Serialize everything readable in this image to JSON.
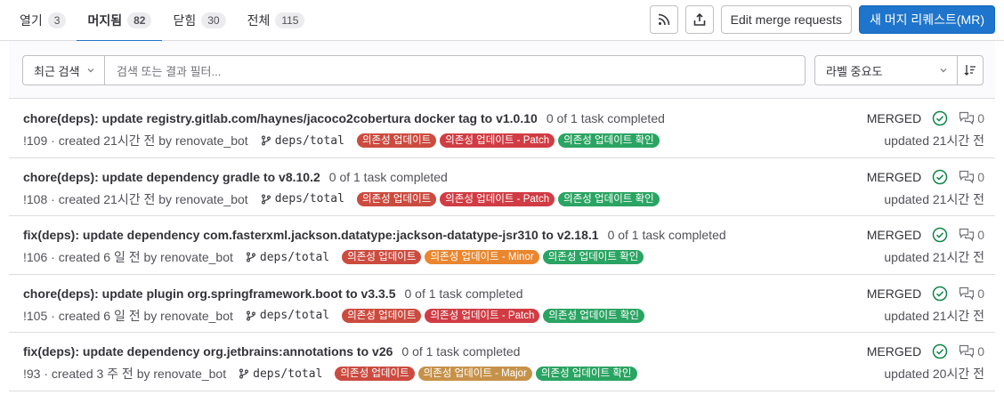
{
  "tabs": [
    {
      "label": "열기",
      "count": "3",
      "active": false
    },
    {
      "label": "머지됨",
      "count": "82",
      "active": true
    },
    {
      "label": "닫힘",
      "count": "30",
      "active": false
    },
    {
      "label": "전체",
      "count": "115",
      "active": false
    }
  ],
  "actions": {
    "rss_icon": "rss-icon",
    "export_icon": "export-icon",
    "edit_label": "Edit merge requests",
    "new_label": "새 머지 리퀘스트(MR)"
  },
  "filter": {
    "recent_label": "최근 검색",
    "search_placeholder": "검색 또는 결과 필터...",
    "sort_label": "라벨 중요도"
  },
  "colors": {
    "accent": "#1f75cb",
    "label_update": "#cc4b3f",
    "label_patch": "#d13c44",
    "label_minor": "#e9862e",
    "label_major": "#c6924a",
    "label_confirm": "#2aa462",
    "merged_check": "#108548"
  },
  "merge_requests": [
    {
      "title": "chore(deps): update registry.gitlab.com/haynes/jacoco2cobertura docker tag to v1.0.10",
      "tasks": "0 of 1 task completed",
      "meta": "!109 · created 21시간 전 by renovate_bot",
      "branch": "deps/total",
      "labels": [
        {
          "text": "의존성 업데이트",
          "color": "#cc4b3f"
        },
        {
          "text": "의존성 업데이트 - Patch",
          "color": "#d13c44"
        },
        {
          "text": "의존성 업데이트 확인",
          "color": "#2aa462"
        }
      ],
      "status": "MERGED",
      "comments": "0",
      "updated": "updated 21시간 전"
    },
    {
      "title": "chore(deps): update dependency gradle to v8.10.2",
      "tasks": "0 of 1 task completed",
      "meta": "!108 · created 21시간 전 by renovate_bot",
      "branch": "deps/total",
      "labels": [
        {
          "text": "의존성 업데이트",
          "color": "#cc4b3f"
        },
        {
          "text": "의존성 업데이트 - Patch",
          "color": "#d13c44"
        },
        {
          "text": "의존성 업데이트 확인",
          "color": "#2aa462"
        }
      ],
      "status": "MERGED",
      "comments": "0",
      "updated": "updated 21시간 전"
    },
    {
      "title": "fix(deps): update dependency com.fasterxml.jackson.datatype:jackson-datatype-jsr310 to v2.18.1",
      "tasks": "0 of 1 task completed",
      "meta": "!106 · created 6 일 전 by renovate_bot",
      "branch": "deps/total",
      "labels": [
        {
          "text": "의존성 업데이트",
          "color": "#cc4b3f"
        },
        {
          "text": "의존성 업데이트 - Minor",
          "color": "#e9862e"
        },
        {
          "text": "의존성 업데이트 확인",
          "color": "#2aa462"
        }
      ],
      "status": "MERGED",
      "comments": "0",
      "updated": "updated 21시간 전"
    },
    {
      "title": "chore(deps): update plugin org.springframework.boot to v3.3.5",
      "tasks": "0 of 1 task completed",
      "meta": "!105 · created 6 일 전 by renovate_bot",
      "branch": "deps/total",
      "labels": [
        {
          "text": "의존성 업데이트",
          "color": "#cc4b3f"
        },
        {
          "text": "의존성 업데이트 - Patch",
          "color": "#d13c44"
        },
        {
          "text": "의존성 업데이트 확인",
          "color": "#2aa462"
        }
      ],
      "status": "MERGED",
      "comments": "0",
      "updated": "updated 21시간 전"
    },
    {
      "title": "fix(deps): update dependency org.jetbrains:annotations to v26",
      "tasks": "0 of 1 task completed",
      "meta": "!93 · created 3 주 전 by renovate_bot",
      "branch": "deps/total",
      "labels": [
        {
          "text": "의존성 업데이트",
          "color": "#cc4b3f"
        },
        {
          "text": "의존성 업데이트 - Major",
          "color": "#c6924a"
        },
        {
          "text": "의존성 업데이트 확인",
          "color": "#2aa462"
        }
      ],
      "status": "MERGED",
      "comments": "0",
      "updated": "updated 20시간 전"
    }
  ]
}
